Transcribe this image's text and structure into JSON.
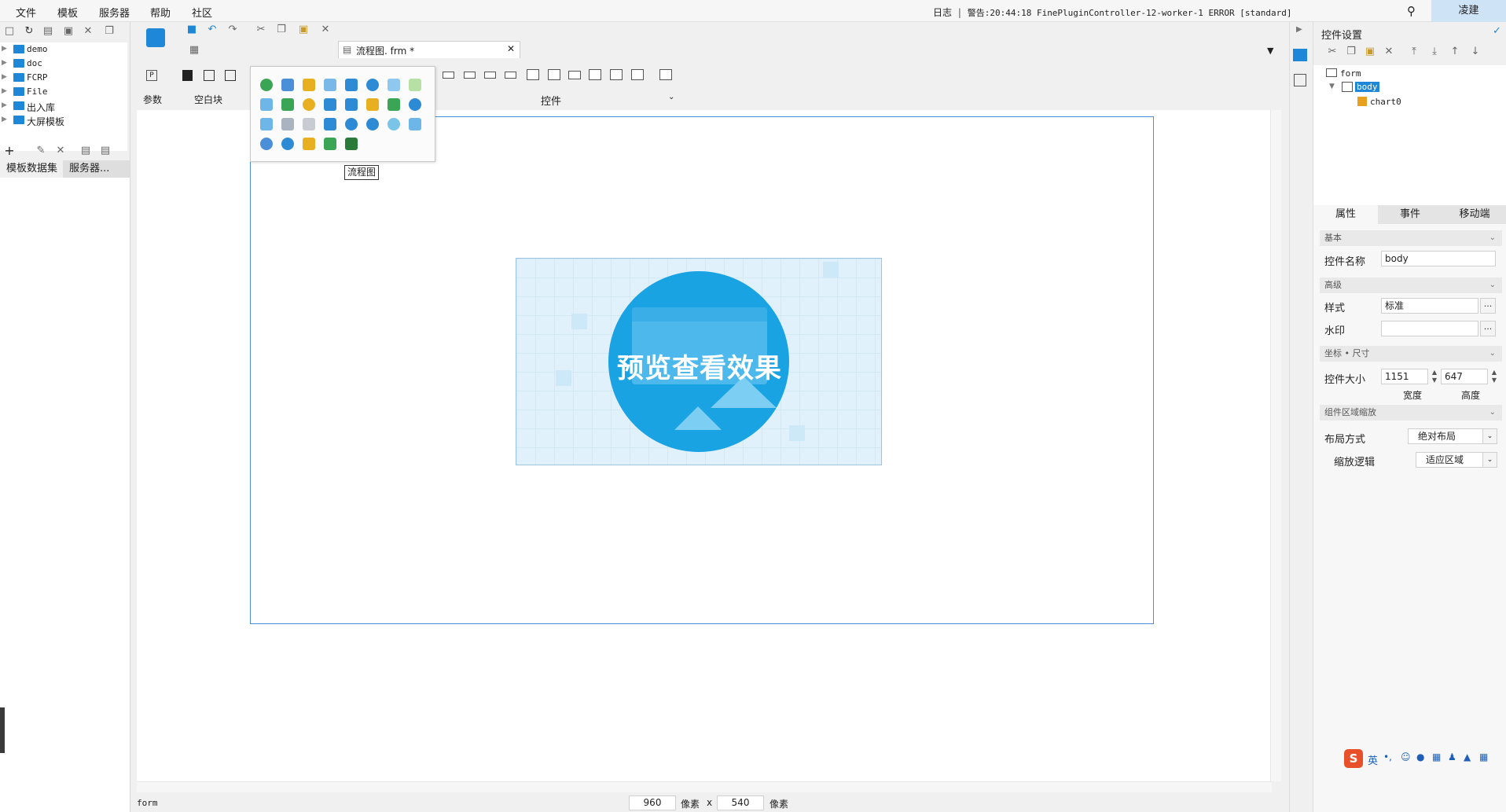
{
  "menubar": {
    "items": [
      "文件",
      "模板",
      "服务器",
      "帮助",
      "社区"
    ],
    "log_label": "日志",
    "warning_text": "警告:20:44:18 FinePluginController-12-worker-1 ERROR [standard]",
    "user": "凌建"
  },
  "left_panel": {
    "tree_items": [
      "demo",
      "doc",
      "FCRP",
      "File",
      "出入库",
      "大屏模板"
    ],
    "tabs": [
      "模板数据集",
      "服务器..."
    ]
  },
  "editor": {
    "doc_tab_title": "流程图. frm *",
    "toolbar_labels": {
      "param": "参数",
      "blank_block": "空白块",
      "widget": "控件"
    },
    "tooltip": "流程图",
    "preview_text": "预览查看效果",
    "status": {
      "left_label": "form",
      "width": "960",
      "unit1": "像素",
      "times": "x",
      "height": "540",
      "unit2": "像素"
    }
  },
  "right_panel": {
    "title": "控件设置",
    "component_tree": [
      "form",
      "body",
      "chart0"
    ],
    "tabs": [
      "属性",
      "事件",
      "移动端"
    ],
    "sections": {
      "basic": "基本",
      "advanced": "高级",
      "coords": "坐标 • 尺寸",
      "zoom": "组件区域缩放"
    },
    "props": {
      "name_label": "控件名称",
      "name_value": "body",
      "style_label": "样式",
      "style_value": "标准",
      "watermark_label": "水印",
      "watermark_value": "",
      "size_label": "控件大小",
      "width_value": "1151",
      "height_value": "647",
      "width_label": "宽度",
      "height_label": "高度",
      "layout_label": "布局方式",
      "layout_value": "绝对布局",
      "zoom_label": "缩放逻辑",
      "zoom_value": "适应区域"
    }
  },
  "ime": {
    "lang": "英"
  },
  "colors": {
    "accent": "#1f87d8",
    "frame": "#4a8fd8",
    "preview_circle": "#1aa3e3"
  }
}
